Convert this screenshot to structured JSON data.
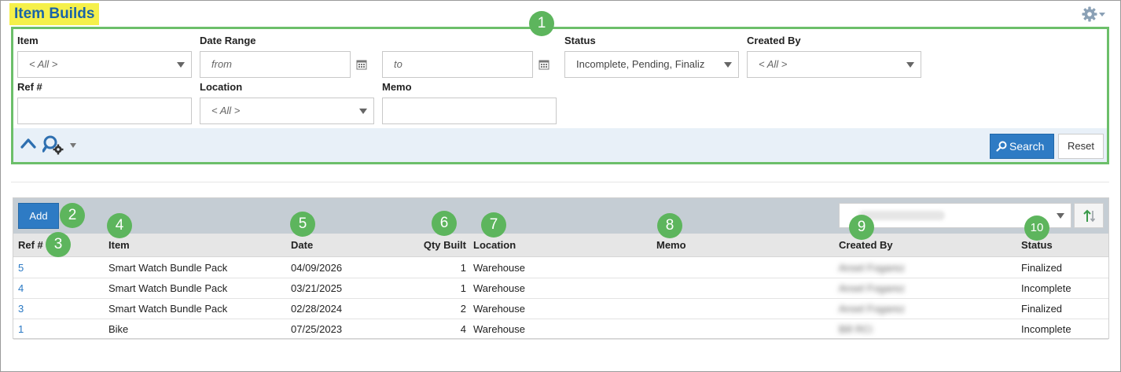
{
  "page": {
    "title": "Item Builds",
    "accent_color": "#2e7bc4",
    "highlight_color": "#f5f04a",
    "callout_color": "#5db55d"
  },
  "icons": {
    "settings": "gear-icon",
    "calendar": "calendar-icon",
    "collapse": "chevron-up-icon",
    "search_options": "magnifier-gear-icon",
    "sort_direction": "sort-arrows-icon"
  },
  "filters": {
    "item": {
      "label": "Item",
      "value": "< All >"
    },
    "date_range": {
      "label": "Date Range",
      "from_placeholder": "from",
      "to_placeholder": "to"
    },
    "status": {
      "label": "Status",
      "value": "Incomplete, Pending, Finaliz"
    },
    "created_by": {
      "label": "Created By",
      "value": "< All >"
    },
    "ref": {
      "label": "Ref #",
      "value": ""
    },
    "location": {
      "label": "Location",
      "value": "< All >"
    },
    "memo": {
      "label": "Memo",
      "value": ""
    },
    "search_button": "Search",
    "reset_button": "Reset"
  },
  "callouts": [
    "1",
    "2",
    "3",
    "4",
    "5",
    "6",
    "7",
    "8",
    "9",
    "10"
  ],
  "grid": {
    "add_button": "Add",
    "sort_value": "Created Date",
    "columns": {
      "ref": "Ref #",
      "item": "Item",
      "date": "Date",
      "qty": "Qty Built",
      "location": "Location",
      "memo": "Memo",
      "created_by": "Created By",
      "status": "Status"
    },
    "rows": [
      {
        "ref": "5",
        "item": "Smart Watch Bundle Pack",
        "date": "04/09/2026",
        "qty": "1",
        "location": "Warehouse",
        "memo": "",
        "created_by": "Ansel Fogarez",
        "status": "Finalized"
      },
      {
        "ref": "4",
        "item": "Smart Watch Bundle Pack",
        "date": "03/21/2025",
        "qty": "1",
        "location": "Warehouse",
        "memo": "",
        "created_by": "Ansel Fogarez",
        "status": "Incomplete"
      },
      {
        "ref": "3",
        "item": "Smart Watch Bundle Pack",
        "date": "02/28/2024",
        "qty": "2",
        "location": "Warehouse",
        "memo": "",
        "created_by": "Ansel Fogarez",
        "status": "Finalized"
      },
      {
        "ref": "1",
        "item": "Bike",
        "date": "07/25/2023",
        "qty": "4",
        "location": "Warehouse",
        "memo": "",
        "created_by": "Bill RCi",
        "status": "Incomplete"
      }
    ]
  }
}
